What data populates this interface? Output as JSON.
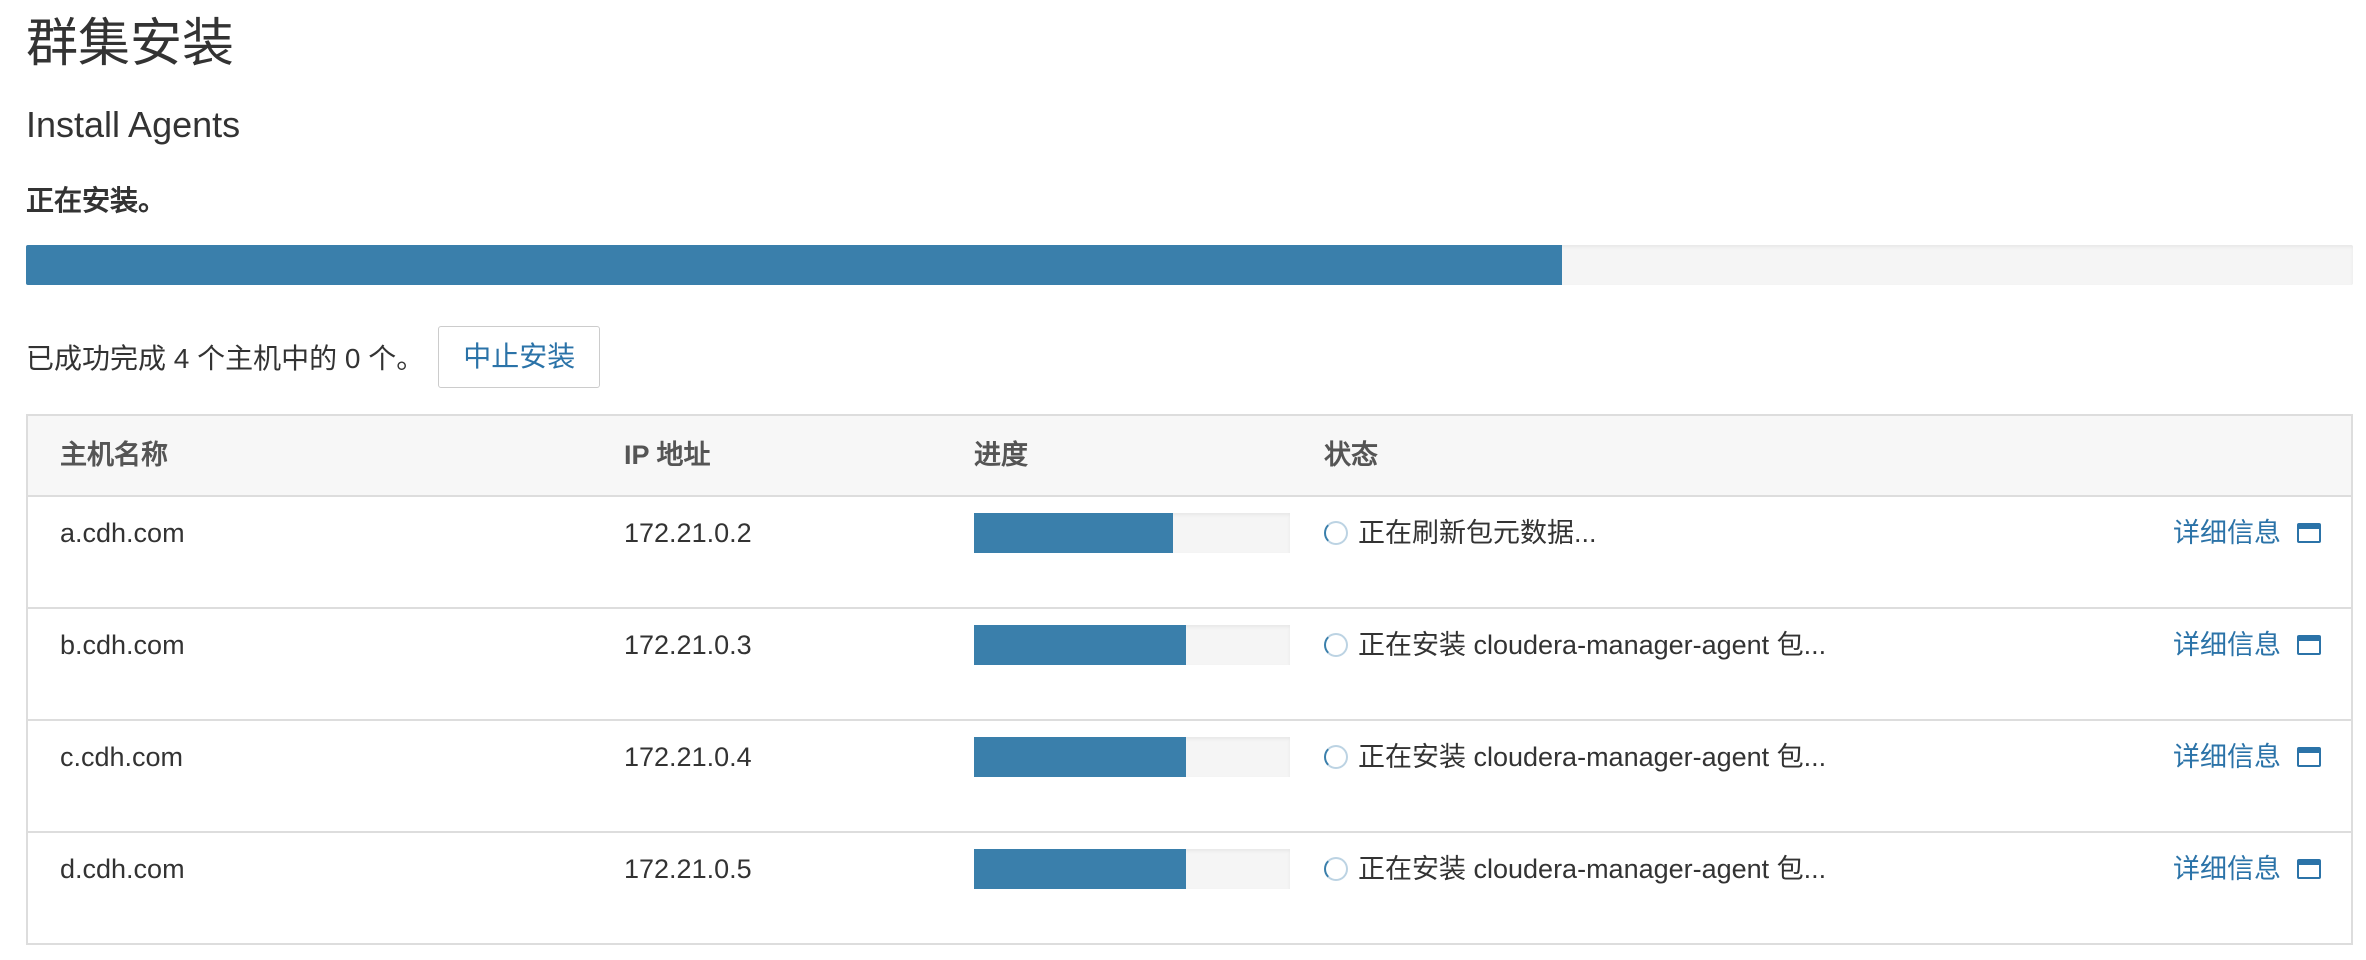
{
  "page": {
    "title": "群集安装",
    "subtitle": "Install Agents",
    "status_text": "正在安装。",
    "overall_progress": 0.66,
    "summary_text": "已成功完成 4 个主机中的 0 个。",
    "abort_button": "中止安装"
  },
  "table": {
    "headers": {
      "host": "主机名称",
      "ip": "IP 地址",
      "progress": "进度",
      "status": "状态"
    },
    "rows": [
      {
        "host": "a.cdh.com",
        "ip": "172.21.0.2",
        "progress": 0.63,
        "status": "正在刷新包元数据...",
        "detail": "详细信息"
      },
      {
        "host": "b.cdh.com",
        "ip": "172.21.0.3",
        "progress": 0.67,
        "status": "正在安装 cloudera-manager-agent 包...",
        "detail": "详细信息"
      },
      {
        "host": "c.cdh.com",
        "ip": "172.21.0.4",
        "progress": 0.67,
        "status": "正在安装 cloudera-manager-agent 包...",
        "detail": "详细信息"
      },
      {
        "host": "d.cdh.com",
        "ip": "172.21.0.5",
        "progress": 0.67,
        "status": "正在安装 cloudera-manager-agent 包...",
        "detail": "详细信息"
      }
    ]
  },
  "icons": {
    "status": "spinner-icon",
    "detail": "window-icon"
  },
  "colors": {
    "progress_fill": "#3a7fab",
    "link": "#2b73a8"
  }
}
